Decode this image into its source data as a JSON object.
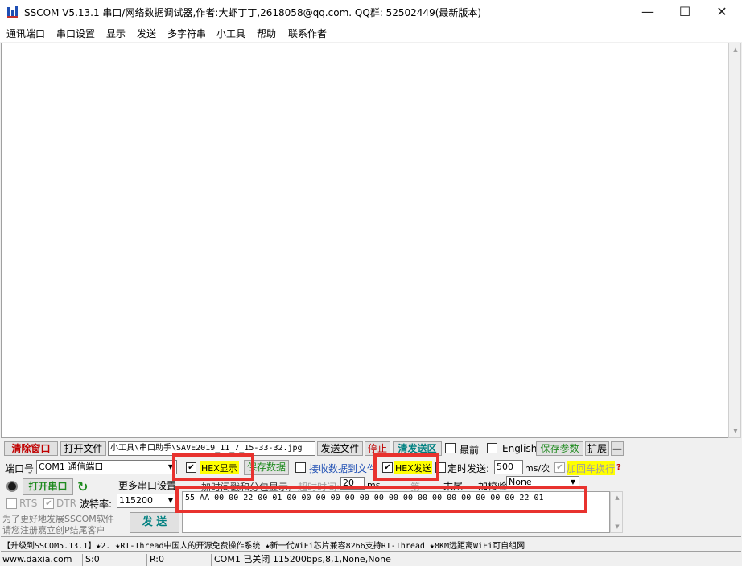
{
  "window": {
    "title": "SSCOM V5.13.1 串口/网络数据调试器,作者:大虾丁丁,2618058@qq.com. QQ群:  52502449(最新版本)",
    "minimize": "—",
    "maximize": "☐",
    "close": "✕"
  },
  "menu": [
    "通讯端口",
    "串口设置",
    "显示",
    "发送",
    "多字符串",
    "小工具",
    "帮助",
    "联系作者"
  ],
  "receive": {
    "content": ""
  },
  "toolbar": {
    "clear_window": "清除窗口",
    "open_file": "打开文件",
    "file_path": "小工具\\串口助手\\SAVE2019_11_7_15-33-32.jpg",
    "send_file": "发送文件",
    "stop": "停止",
    "clear_send": "清发送区",
    "topmost_label": "最前",
    "english_label": "English",
    "save_params": "保存参数",
    "expand": "扩展",
    "collapse": "—"
  },
  "row2": {
    "port_label": "端口号",
    "port_value": "COM1 通信端口",
    "hex_display_label": "HEX显示",
    "hex_display_checked": "✔",
    "save_data": "保存数据",
    "recv_to_file_label": "接收数据到文件",
    "hex_send_label": "HEX发送",
    "hex_send_checked": "✔",
    "timed_send_label": "定时发送:",
    "interval_value": "500",
    "interval_unit": "ms/次",
    "add_crlf_label": "加回车换行",
    "add_crlf_checked": "✔",
    "help_mark": "?"
  },
  "row3": {
    "open_port": "打开串口",
    "more_settings": "更多串口设置",
    "timestamp_label": "加时间戳和分包显示,",
    "timeout_label": "超时时间:",
    "timeout_value": "20",
    "timeout_unit": "ms",
    "byte_label": "第",
    "end_label": "末尾",
    "checksum_label": "加校验",
    "checksum_value": "None"
  },
  "row4": {
    "rts_label": "RTS",
    "dtr_label": "DTR",
    "dtr_checked": "✔",
    "baud_label": "波特率:",
    "baud_value": "115200",
    "send_data": "55 AA 00 00 22 00 01 00 00 00 00 00 00 00 00 00 00 00 00 00 00 00 00 22 01",
    "send_button": "发 送"
  },
  "promo": {
    "line1": "为了更好地发展SSCOM软件",
    "line2": "请您注册嘉立创P结尾客户"
  },
  "ticker": "【升级到SSCOM5.13.1】★2. ★RT-Thread中国人的开源免费操作系统 ★新一代WiFi芯片兼容8266支持RT-Thread ★8KM远距离WiFi可自组网",
  "statusbar": {
    "site": "www.daxia.com",
    "sent": "S:0",
    "received": "R:0",
    "port_status": "COM1 已关闭  115200bps,8,1,None,None"
  },
  "colors": {
    "highlight_red": "#e8322e",
    "hex_label_yellow": "#ffff00",
    "accent_teal": "#008080",
    "open_port_green": "#1e8a1e",
    "save_params_green": "#1e8a1e",
    "stop_red": "#c00000"
  }
}
